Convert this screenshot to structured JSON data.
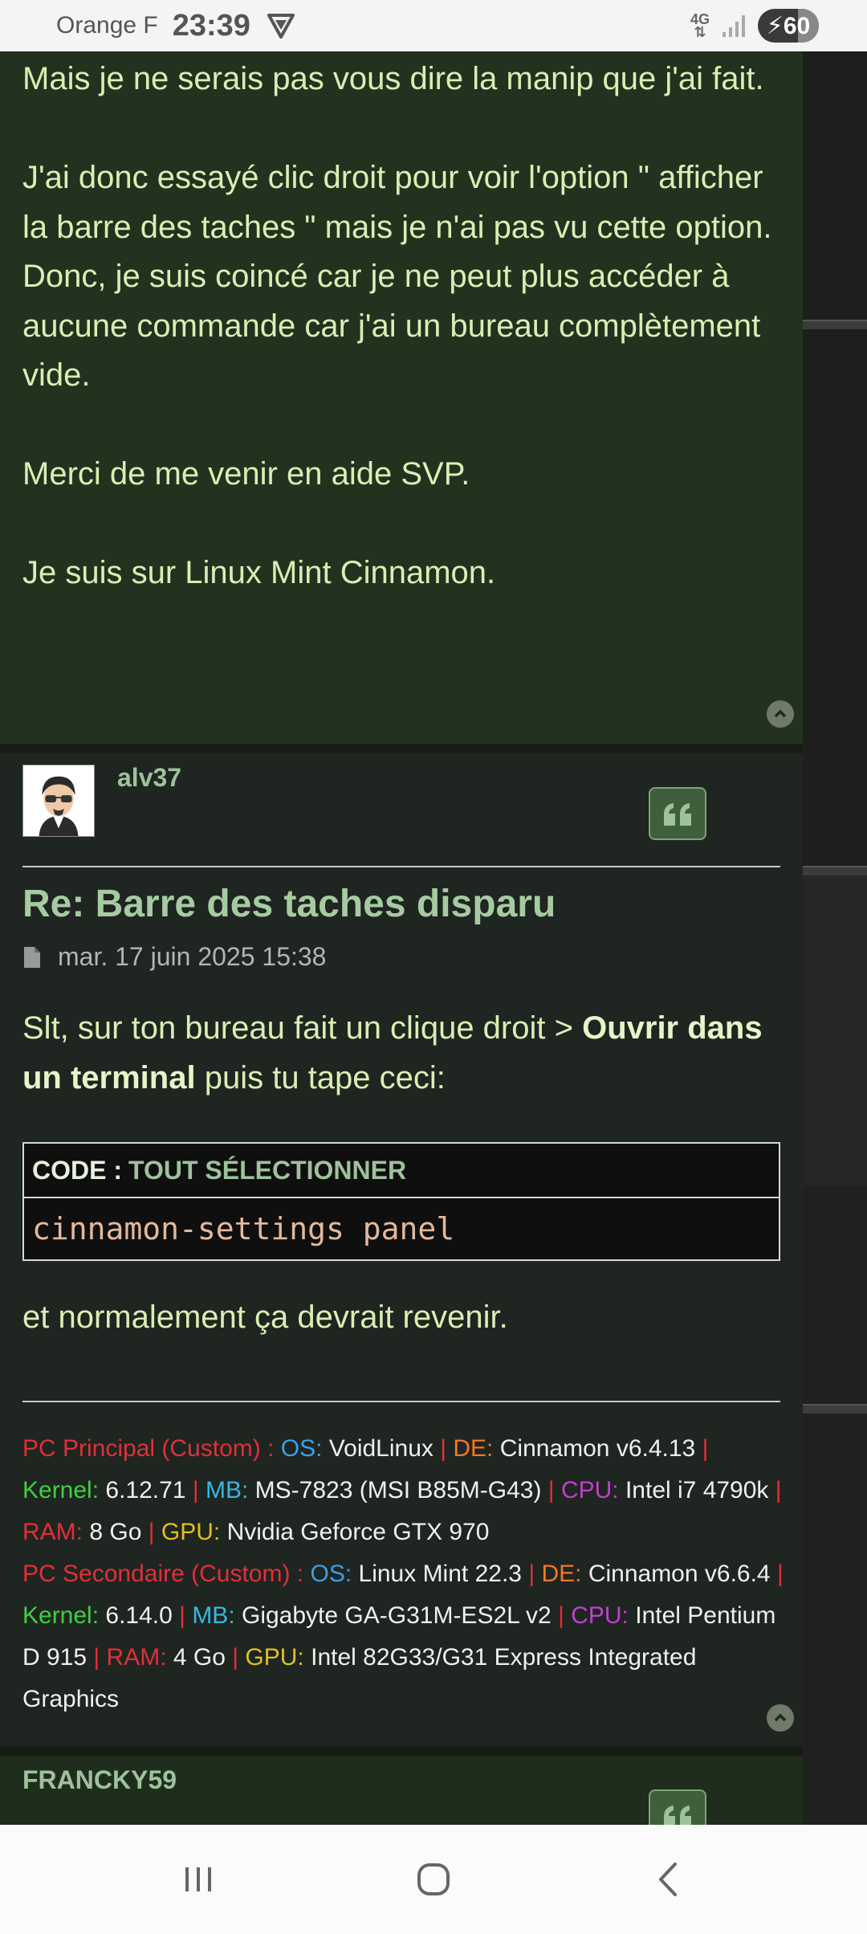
{
  "status_bar": {
    "carrier": "Orange F",
    "time": "23:39",
    "network_type": "4G",
    "battery_level": "60"
  },
  "post1": {
    "paragraphs": [
      "Mais je ne serais pas vous dire la manip que j'ai fait.",
      "",
      "J'ai donc essayé clic droit pour voir l'option \" afficher la barre des taches \" mais je n'ai pas vu cette option.",
      "Donc, je suis coincé car je ne peut plus accéder à aucune commande car j'ai un bureau complètement vide.",
      "",
      "Merci de me venir en aide SVP.",
      "",
      "Je suis sur Linux Mint Cinnamon."
    ]
  },
  "post2": {
    "username": "alv37",
    "title": "Re: Barre des taches disparu",
    "date": "mar. 17 juin 2025 15:38",
    "reply_prefix": "Slt, sur ton bureau fait un clique droit > ",
    "reply_bold": "Ouvrir dans un terminal",
    "reply_suffix": " puis tu tape ceci:",
    "code_label": "CODE :",
    "code_select": "TOUT SÉLECTIONNER",
    "code": "cinnamon-settings panel",
    "after_code": "et normalement ça devrait revenir.",
    "signature": {
      "pc1_name": "PC Principal (Custom) :",
      "os_label": "OS:",
      "pc1_os": "VoidLinux",
      "sep": "|",
      "de_label": "DE:",
      "pc1_de": "Cinnamon v6.4.13",
      "kernel_label": "Kernel:",
      "pc1_kernel": "6.12.71",
      "mb_label": "MB:",
      "pc1_mb": "MS-7823 (MSI B85M-G43)",
      "cpu_label": "CPU:",
      "pc1_cpu": "Intel i7 4790k",
      "ram_label": "RAM:",
      "pc1_ram": "8 Go",
      "gpu_label": "GPU:",
      "pc1_gpu": "Nvidia Geforce GTX 970",
      "pc2_name": "PC Secondaire (Custom) :",
      "pc2_os": "Linux Mint 22.3",
      "pc2_de": "Cinnamon v6.6.4",
      "pc2_kernel": "6.14.0",
      "pc2_mb": "Gigabyte GA-G31M-ES2L v2",
      "pc2_cpu": "Intel Pentium D 915",
      "pc2_ram": "4 Go",
      "pc2_gpu": "Intel 82G33/G31 Express Integrated Graphics"
    }
  },
  "post3": {
    "username": "FRANCKY59"
  },
  "colors": {
    "post_bg": "#22321f",
    "body_text": "#d8efb4",
    "accent_green": "#9ec29b",
    "quote_button": "#3f5e3b"
  },
  "icons": {
    "vpn": "vpn-shield-icon",
    "signal": "signal-icon",
    "back_to_top": "chevron-up-icon",
    "quote": "quote-icon",
    "post_date": "file-icon",
    "nav_recents": "recents-icon",
    "nav_home": "home-icon",
    "nav_back": "back-icon"
  }
}
